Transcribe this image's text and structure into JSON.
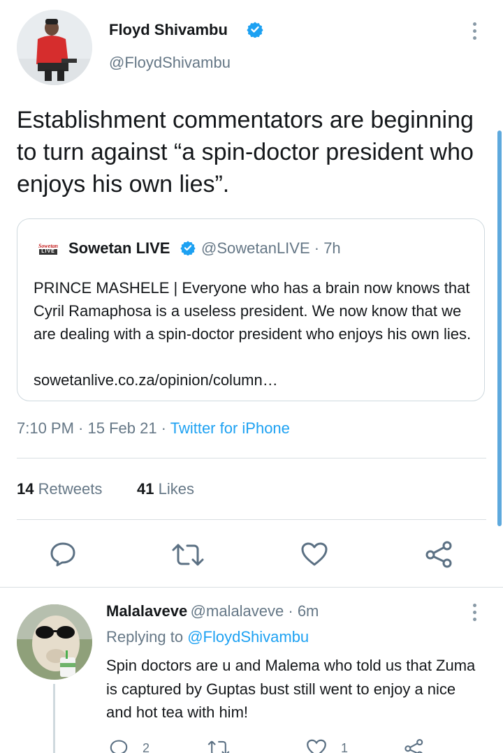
{
  "tweet": {
    "author_name": "Floyd Shivambu",
    "author_handle": "@FloydShivambu",
    "text": "Establishment commentators are beginning to turn against “a spin-doctor president who enjoys his own lies”.",
    "quoted": {
      "source_logo_top": "Sowetan",
      "source_logo_bottom": "LIVE",
      "name": "Sowetan LIVE",
      "handle_time": "@SowetanLIVE · 7h",
      "text": "PRINCE MASHELE | Everyone who has a brain now knows that Cyril Ramaphosa is a useless president. We now know that we are dealing with a spin-doctor president who enjoys his own lies.",
      "link": "sowetanlive.co.za/opinion/column…"
    },
    "timestamp": "7:10 PM · 15 Feb 21 ·",
    "client": "Twitter for iPhone",
    "retweets_count": "14",
    "retweets_label": "Retweets",
    "likes_count": "41",
    "likes_label": "Likes"
  },
  "actions": {
    "reply_icon": "reply-icon",
    "retweet_icon": "retweet-icon",
    "like_icon": "heart-icon",
    "share_icon": "share-icon"
  },
  "reply": {
    "author_name": "Malalaveve",
    "author_handle_time": "@malalaveve · 6m",
    "replying_prefix": "Replying to",
    "replying_to": "@FloydShivambu",
    "text": "Spin doctors are u and Malema who told us that Zuma is captured by Guptas bust still went to enjoy a nice and hot tea with him!",
    "reply_count": "2",
    "like_count": "1"
  },
  "colors": {
    "accent": "#1da1f2",
    "text": "#14171a",
    "secondary": "#657786",
    "verified": "#1da1f2"
  }
}
